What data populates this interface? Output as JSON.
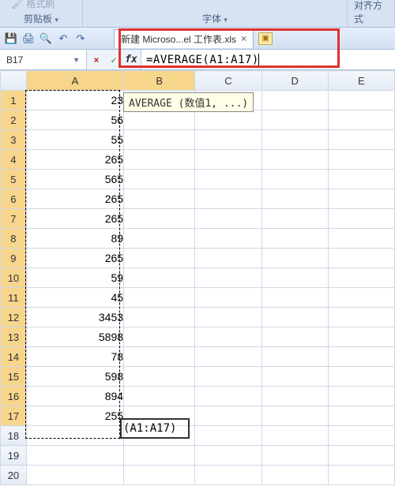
{
  "ribbon": {
    "format_brush": "格式刷",
    "clipboard_label": "剪贴板",
    "font_label": "字体",
    "align_label": "对齐方式"
  },
  "quick_access": {
    "save": "💾",
    "print": "🖨",
    "preview": "🔍",
    "undo": "↶",
    "redo": "↷"
  },
  "tab": {
    "title": "新建 Microso...el 工作表.xls",
    "close": "×"
  },
  "namebox": {
    "ref": "B17"
  },
  "formula_bar": {
    "cancel": "×",
    "confirm": "✓",
    "fx": "fx",
    "text": "=AVERAGE(A1:A17)"
  },
  "columns": [
    "A",
    "B",
    "C",
    "D",
    "E"
  ],
  "row_count": 20,
  "tooltip": "AVERAGE (数值1, ...)",
  "inline_edit_text": "(A1:A17)",
  "chart_data": {
    "type": "table",
    "columns": [
      "A"
    ],
    "rows": [
      {
        "row": 1,
        "A": 23
      },
      {
        "row": 2,
        "A": 56
      },
      {
        "row": 3,
        "A": 55
      },
      {
        "row": 4,
        "A": 265
      },
      {
        "row": 5,
        "A": 565
      },
      {
        "row": 6,
        "A": 265
      },
      {
        "row": 7,
        "A": 265
      },
      {
        "row": 8,
        "A": 89
      },
      {
        "row": 9,
        "A": 265
      },
      {
        "row": 10,
        "A": 59
      },
      {
        "row": 11,
        "A": 45
      },
      {
        "row": 12,
        "A": 3453
      },
      {
        "row": 13,
        "A": 5898
      },
      {
        "row": 14,
        "A": 78
      },
      {
        "row": 15,
        "A": 598
      },
      {
        "row": 16,
        "A": 894
      },
      {
        "row": 17,
        "A": 255
      }
    ]
  }
}
